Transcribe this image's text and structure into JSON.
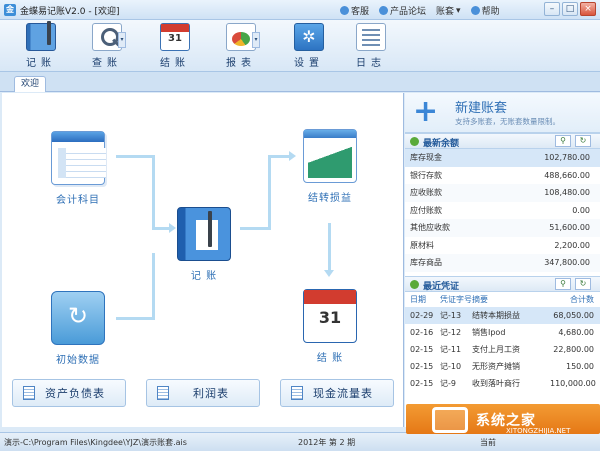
{
  "window": {
    "title": "金蝶易记账V2.0 - [欢迎]",
    "links": [
      "客服",
      "产品论坛",
      "账套",
      "帮助"
    ]
  },
  "toolbar": [
    {
      "label": "记账",
      "icon": "journal-book-icon"
    },
    {
      "label": "查账",
      "icon": "search-icon"
    },
    {
      "label": "结账",
      "icon": "calendar-icon",
      "icon_text": "31"
    },
    {
      "label": "报表",
      "icon": "report-chart-icon"
    },
    {
      "label": "设置",
      "icon": "gear-icon"
    },
    {
      "label": "日志",
      "icon": "log-list-icon"
    }
  ],
  "tabs": [
    {
      "label": "欢迎"
    }
  ],
  "flow": {
    "accounts": "会计科目",
    "transfer": "结转损益",
    "bookkeeping": "记 账",
    "initial": "初始数据",
    "closing": "结 账",
    "calendar_day": "31"
  },
  "reports": [
    "资产负债表",
    "利润表",
    "现金流量表"
  ],
  "panel": {
    "new_set_title": "新建账套",
    "new_set_subtitle": "支持多账套，无账套数量限制。",
    "balance_title": "最新余额",
    "balances": [
      {
        "name": "库存现金",
        "value": "102,780.00"
      },
      {
        "name": "银行存款",
        "value": "488,660.00"
      },
      {
        "name": "应收账款",
        "value": "108,480.00"
      },
      {
        "name": "应付账款",
        "value": "0.00"
      },
      {
        "name": "其他应收款",
        "value": "51,600.00"
      },
      {
        "name": "原材料",
        "value": "2,200.00"
      },
      {
        "name": "库存商品",
        "value": "347,800.00"
      }
    ],
    "voucher_title": "最近凭证",
    "voucher_headers": [
      "日期",
      "凭证字号",
      "摘要",
      "合计数"
    ],
    "vouchers": [
      {
        "date": "02-29",
        "no": "记-13",
        "summary": "结转本期损益",
        "amount": "68,050.00"
      },
      {
        "date": "02-16",
        "no": "记-12",
        "summary": "销售Ipod",
        "amount": "4,680.00"
      },
      {
        "date": "02-15",
        "no": "记-11",
        "summary": "支付上月工资",
        "amount": "22,800.00"
      },
      {
        "date": "02-15",
        "no": "记-10",
        "summary": "无形资产摊销",
        "amount": "150.00"
      },
      {
        "date": "02-15",
        "no": "记-9",
        "summary": "收到落叶商行",
        "amount": "110,000.00"
      }
    ]
  },
  "status": {
    "path": "演示-C:\\Program Files\\Kingdee\\YJZ\\演示账套.ais",
    "period": "2012年 第 2 期",
    "right": "当前"
  },
  "watermark": {
    "title": "系统之家",
    "sub": "XITONGZHIJIA.NET"
  }
}
